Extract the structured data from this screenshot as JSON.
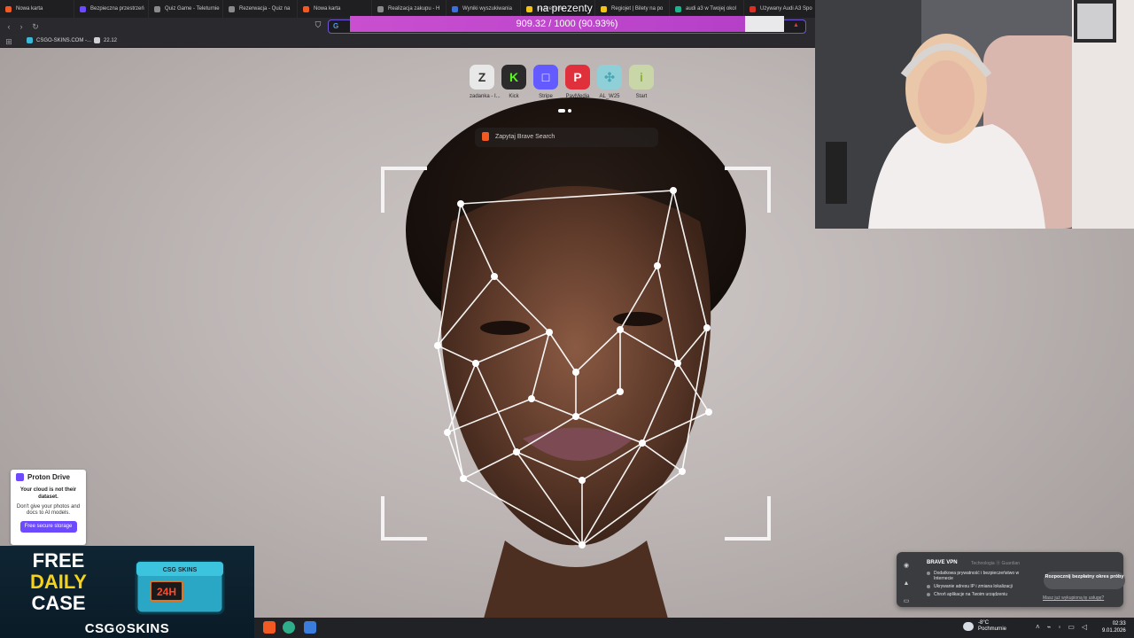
{
  "tabs": [
    {
      "label": "Nowa karta",
      "color": "#f25a22"
    },
    {
      "label": "Bezpieczna przestrzeń",
      "color": "#6d4aff"
    },
    {
      "label": "Quiz Game - Teleturnie",
      "color": "#8a8a8a"
    },
    {
      "label": "Rezerwacja - Quiz na",
      "color": "#8a8a8a"
    },
    {
      "label": "Nowa karta",
      "color": "#f25a22"
    },
    {
      "label": "Realizacja zakupu - H",
      "color": "#8a8a8a"
    },
    {
      "label": "Wyniki wyszukiwania",
      "color": "#3f6fd8"
    },
    {
      "label": "na prezenty",
      "color": "#f0c419"
    },
    {
      "label": "Regiojet | Bilety na po",
      "color": "#f0c419"
    },
    {
      "label": "audi a3 w Twojej okol",
      "color": "#1db38c"
    },
    {
      "label": "Używany Audi A3 Spo",
      "color": "#d93025"
    }
  ],
  "bookmarks": [
    {
      "label": "CSGO-SKINS.COM -..."
    },
    {
      "label": "22.12"
    }
  ],
  "goal": {
    "heading": "na prezenty",
    "text": "909.32 / 1000 (90.93%)",
    "progress": 0.9093
  },
  "shortcuts": [
    {
      "label": "zadanka - I...",
      "icon": "Z",
      "bg": "#e8e8e8",
      "fg": "#333"
    },
    {
      "label": "Kick",
      "icon": "K",
      "bg": "#2b2b2b",
      "fg": "#53fc18"
    },
    {
      "label": "Stripe",
      "icon": "□",
      "bg": "#635bff",
      "fg": "#fff"
    },
    {
      "label": "PayMedia",
      "icon": "P",
      "bg": "#e0303c",
      "fg": "#fff"
    },
    {
      "label": "AL_W25",
      "icon": "✣",
      "bg": "#8fd0d8",
      "fg": "#4aa6b4"
    },
    {
      "label": "Start",
      "icon": "i",
      "bg": "#c9d6a8",
      "fg": "#8fb040"
    }
  ],
  "search": {
    "placeholder": "Zapytaj Brave Search"
  },
  "proton": {
    "brand": "Proton Drive",
    "headline": "Your cloud is not their dataset.",
    "body": "Don't give your photos and docs to AI models.",
    "cta": "Free secure storage"
  },
  "csgo_ad": {
    "line1": "FREE",
    "line2": "DAILY",
    "line3": "CASE",
    "chest_label": "CSG SKINS",
    "chest_badge": "24H",
    "brand": "CSG⊙SKINS"
  },
  "vpn": {
    "title": "BRAVE VPN",
    "by": "Technologia ⓖ Guardian",
    "features": [
      "Dodatkowa prywatność i bezpieczeństwo w Internecie",
      "Ukrywanie adresu IP i zmiana lokalizacji",
      "Chroń aplikacje na Twoim urządzeniu"
    ],
    "cta": "Rozpocznij bezpłatny okres próby",
    "link": "Masz już wykupioną tę usługę?"
  },
  "taskbar": {
    "weather_temp": "-8°C",
    "weather_desc": "Pochmurnie",
    "time": "02:33",
    "date": "9.01.2026"
  }
}
